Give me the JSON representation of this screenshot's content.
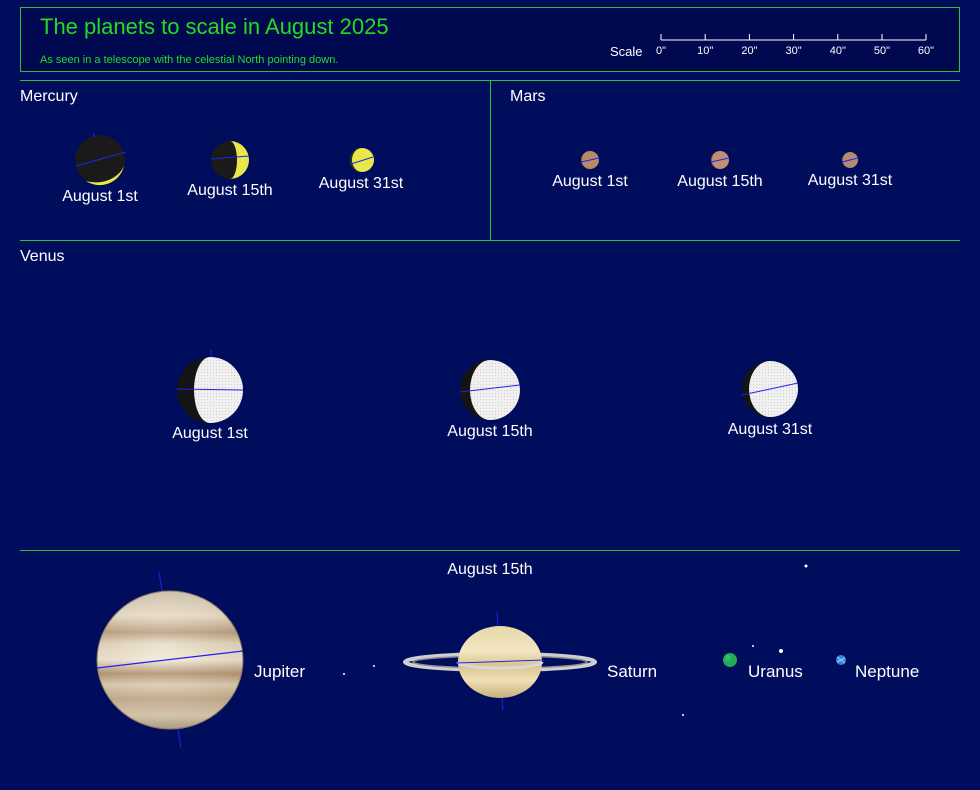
{
  "header": {
    "title": "The planets to scale in August 2025",
    "subtitle": "As seen in a telescope with the celestial North pointing down.",
    "scale_label": "Scale",
    "scale_ticks": [
      "0\"",
      "10\"",
      "20\"",
      "30\"",
      "40\"",
      "50\"",
      "60\""
    ]
  },
  "mercury": {
    "name": "Mercury",
    "dates": [
      "August 1st",
      "August 15th",
      "August 31st"
    ]
  },
  "mars": {
    "name": "Mars",
    "dates": [
      "August 1st",
      "August 15th",
      "August 31st"
    ]
  },
  "venus": {
    "name": "Venus",
    "dates": [
      "August 1st",
      "August 15th",
      "August 31st"
    ]
  },
  "outer": {
    "date": "August 15th",
    "jupiter": "Jupiter",
    "saturn": "Saturn",
    "uranus": "Uranus",
    "neptune": "Neptune"
  },
  "colors": {
    "background": "#000c5c",
    "border": "#2fbf3a",
    "title": "#22dd22",
    "mercury": "#e8e84a",
    "venus": "#eeeeee",
    "mars": "#b88a6a",
    "uranus": "#22aa55",
    "neptune": "#3388dd",
    "axis_line": "#2222ee"
  }
}
